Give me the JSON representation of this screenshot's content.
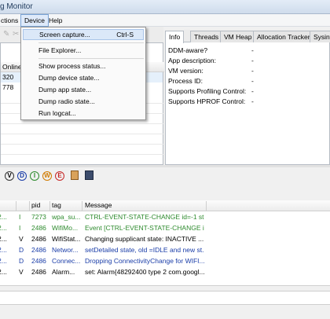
{
  "window": {
    "title": "g Monitor"
  },
  "menubar": {
    "items": [
      "ctions",
      "Device",
      "Help"
    ]
  },
  "device_menu": {
    "items": [
      {
        "label": "Screen capture...",
        "shortcut": "Ctrl-S"
      },
      {
        "label": "File Explorer...",
        "shortcut": ""
      },
      {
        "label": "Show process status...",
        "shortcut": ""
      },
      {
        "label": "Dump device state...",
        "shortcut": ""
      },
      {
        "label": "Dump app state...",
        "shortcut": ""
      },
      {
        "label": "Dump radio state...",
        "shortcut": ""
      },
      {
        "label": "Run logcat...",
        "shortcut": ""
      }
    ]
  },
  "devices": {
    "rows": [
      "Online",
      "320",
      "778"
    ]
  },
  "info_tabs": {
    "tabs": [
      "Info",
      "Threads",
      "VM Heap",
      "Allocation Tracker",
      "Sysinf"
    ]
  },
  "info": {
    "rows": [
      {
        "label": "DDM-aware?",
        "value": "-"
      },
      {
        "label": "App description:",
        "value": "-"
      },
      {
        "label": "VM version:",
        "value": "-"
      },
      {
        "label": "Process ID:",
        "value": "-"
      },
      {
        "label": "Supports Profiling Control:",
        "value": "-"
      },
      {
        "label": "Supports HPROF Control:",
        "value": "-"
      }
    ]
  },
  "log_levels": [
    "V",
    "D",
    "I",
    "W",
    "E"
  ],
  "log_table": {
    "headers": {
      "level": "",
      "pid": "pid",
      "tag": "tag",
      "message": "Message"
    },
    "rows": [
      {
        "time": "2...",
        "level": "I",
        "pid": "7273",
        "tag": "wpa_su...",
        "message": "CTRL-EVENT-STATE-CHANGE id=-1 st...",
        "color": "#2e8b2e"
      },
      {
        "time": "2...",
        "level": "I",
        "pid": "2486",
        "tag": "WifiMo...",
        "message": "Event [CTRL-EVENT-STATE-CHANGE i...",
        "color": "#2e8b2e"
      },
      {
        "time": "2...",
        "level": "V",
        "pid": "2486",
        "tag": "WifiStat...",
        "message": "Changing supplicant state: INACTIVE ...",
        "color": "#000000"
      },
      {
        "time": "2...",
        "level": "D",
        "pid": "2486",
        "tag": "Networ...",
        "message": "setDetailed state, old =IDLE and new st...",
        "color": "#1a3da8"
      },
      {
        "time": "2...",
        "level": "D",
        "pid": "2486",
        "tag": "Connec...",
        "message": "Dropping ConnectivityChange for WIFI...",
        "color": "#1a3da8"
      },
      {
        "time": "2...",
        "level": "V",
        "pid": "2486",
        "tag": "Alarm...",
        "message": "set: Alarm{48292400 type 2 com.googl...",
        "color": "#000000"
      }
    ]
  },
  "colors": {
    "verbose": "#000000",
    "debug": "#1a3da8",
    "info": "#2e8b2e",
    "warn": "#d07a00",
    "error": "#c62828"
  }
}
